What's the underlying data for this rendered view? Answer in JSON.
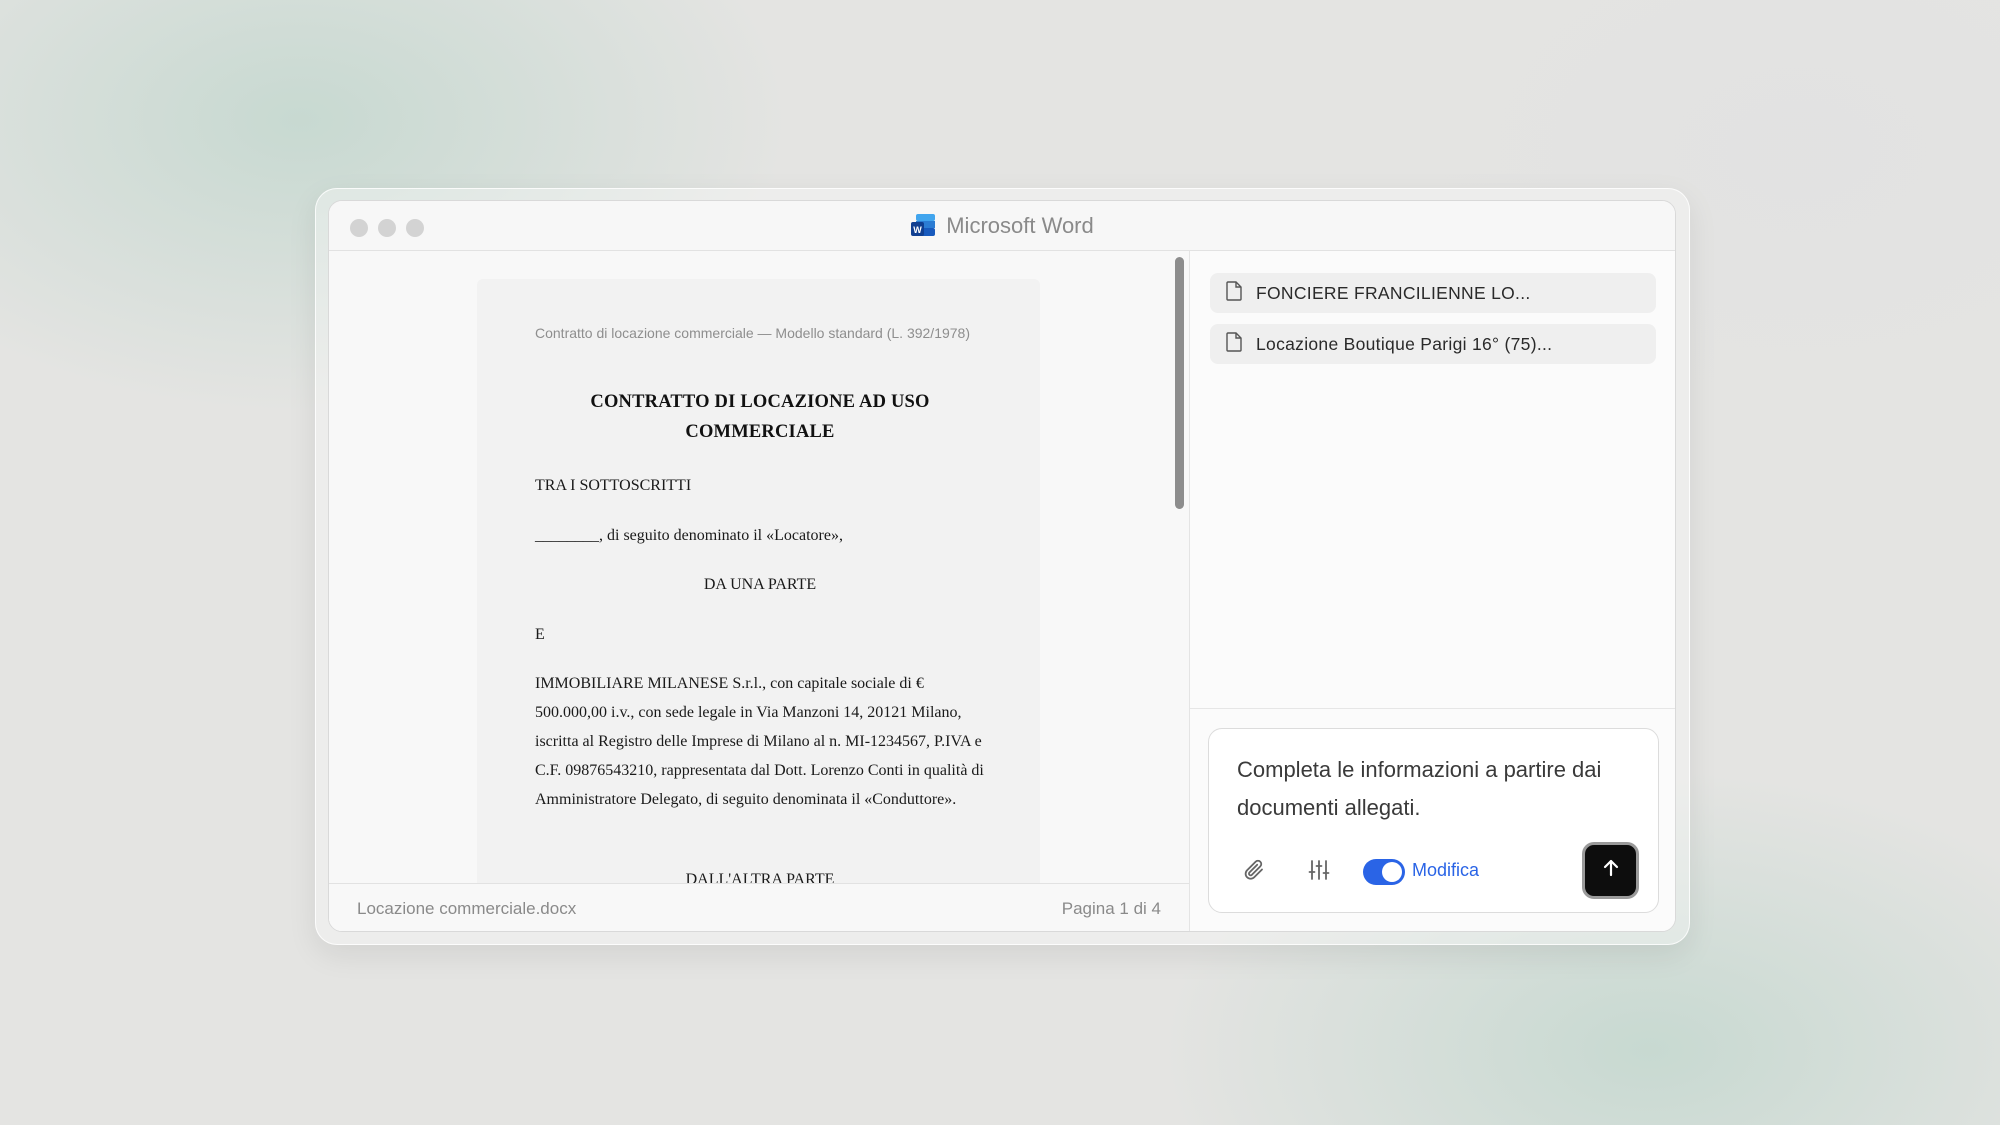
{
  "window": {
    "title": "Microsoft Word"
  },
  "document": {
    "header_note": "Contratto di locazione commerciale — Modello standard (L. 392/1978)",
    "title": "CONTRATTO DI LOCAZIONE AD USO COMMERCIALE",
    "paragraphs": {
      "p1": "TRA I SOTTOSCRITTI",
      "p2": "________, di seguito denominato il «Locatore»,",
      "p3": "DA UNA PARTE",
      "p4": "E",
      "p5": "IMMOBILIARE MILANESE S.r.l., con capitale sociale di € 500.000,00 i.v., con sede legale in Via Manzoni 14, 20121 Milano, iscritta al Registro delle Imprese di Milano al n. MI-1234567, P.IVA e C.F. 09876543210, rappresentata dal Dott. Lorenzo Conti in qualità di Amministratore Delegato, di seguito denominata il «Conduttore».",
      "p6": "DALL'ALTRA PARTE"
    }
  },
  "statusbar": {
    "filename": "Locazione commerciale.docx",
    "page_info": "Pagina 1 di 4"
  },
  "attachments": [
    {
      "name": "FONCIERE FRANCILIENNE LO...",
      "icon": "document-icon"
    },
    {
      "name": "Locazione Boutique Parigi 16° (75)...",
      "icon": "document-icon"
    }
  ],
  "composer": {
    "prompt": "Completa le informazioni a partire dai documenti allegati.",
    "toggle_label": "Modifica",
    "toggle_on": true
  },
  "colors": {
    "accent": "#2a64e6",
    "send_button": "#0d0d0d"
  }
}
